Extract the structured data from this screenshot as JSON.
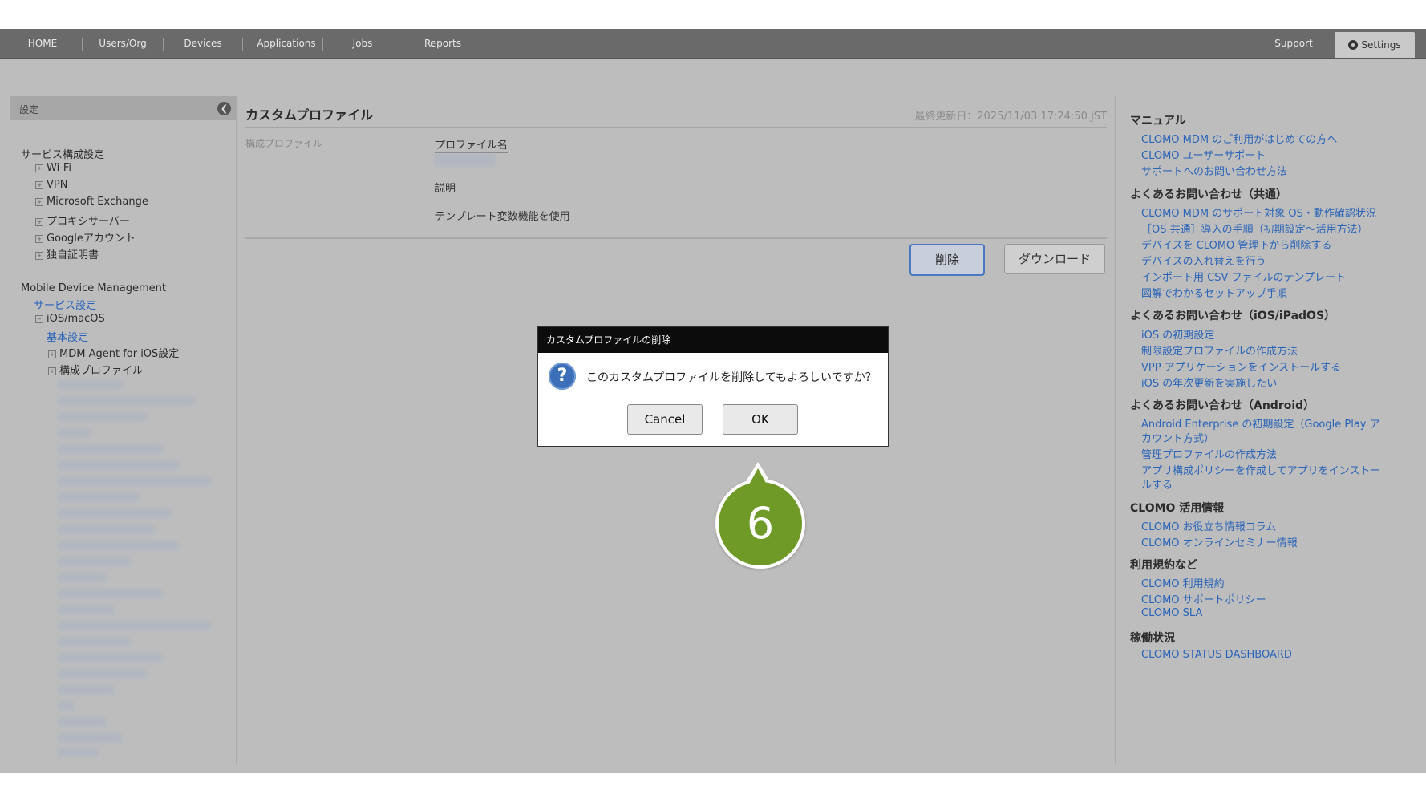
{
  "nav": {
    "items": [
      "HOME",
      "Users/Org",
      "Devices",
      "Applications",
      "Jobs",
      "Reports"
    ],
    "support": "Support",
    "settings": "Settings"
  },
  "sidebar": {
    "header": "設定",
    "service_section": "サービス構成設定",
    "service_items": [
      "Wi-Fi",
      "VPN",
      "Microsoft Exchange",
      "プロキシサーバー",
      "Googleアカウント",
      "独自証明書"
    ],
    "mdm_title": "Mobile Device Management",
    "mdm_service": "サービス設定",
    "ios_macos": "iOS/macOS",
    "basic": "基本設定",
    "agent": "MDM Agent for iOS設定",
    "profiles": "構成プロファイル"
  },
  "main": {
    "title": "カスタムプロファイル",
    "updated": "最終更新日：2025/11/03 17:24:50 JST",
    "section_label": "構成プロファイル",
    "profile_name_label": "プロファイル名",
    "description_label": "説明",
    "template_label": "テンプレート変数機能を使用",
    "delete_button": "削除",
    "download_button": "ダウンロード"
  },
  "dialog": {
    "title": "カスタムプロファイルの削除",
    "message": "このカスタムプロファイルを削除してもよろしいですか？",
    "cancel": "Cancel",
    "ok": "OK"
  },
  "step_marker": "6",
  "right": {
    "manual_heading": "マニュアル",
    "manual_links": [
      "CLOMO MDM のご利用がはじめての方へ",
      "CLOMO ユーザーサポート",
      "サポートへのお問い合わせ方法"
    ],
    "faq_common_heading": "よくあるお問い合わせ（共通）",
    "faq_common_links": [
      "CLOMO MDM のサポート対象 OS・動作確認状況",
      "［OS 共通］導入の手順（初期設定〜活用方法）",
      "デバイスを CLOMO 管理下から削除する",
      "デバイスの入れ替えを行う",
      "インポート用 CSV ファイルのテンプレート",
      "図解でわかるセットアップ手順"
    ],
    "faq_ios_heading": "よくあるお問い合わせ（iOS/iPadOS）",
    "faq_ios_links": [
      "iOS の初期設定",
      "制限設定プロファイルの作成方法",
      "VPP アプリケーションをインストールする",
      "iOS の年次更新を実施したい"
    ],
    "faq_android_heading": "よくあるお問い合わせ（Android）",
    "faq_android_links": [
      "Android Enterprise の初期設定（Google Play ア",
      "カウント方式）",
      "管理プロファイルの作成方法",
      "アプリ構成ポリシーを作成してアプリをインストー",
      "ルする"
    ],
    "tips_heading": "CLOMO 活用情報",
    "tips_links": [
      "CLOMO お役立ち情報コラム",
      "CLOMO オンラインセミナー情報"
    ],
    "terms_heading": "利用規約など",
    "terms_links": [
      "CLOMO 利用規約",
      "CLOMO サポートポリシー",
      "CLOMO SLA"
    ],
    "status_heading": "稼働状況",
    "status_links": [
      "CLOMO STATUS DASHBOARD"
    ]
  }
}
